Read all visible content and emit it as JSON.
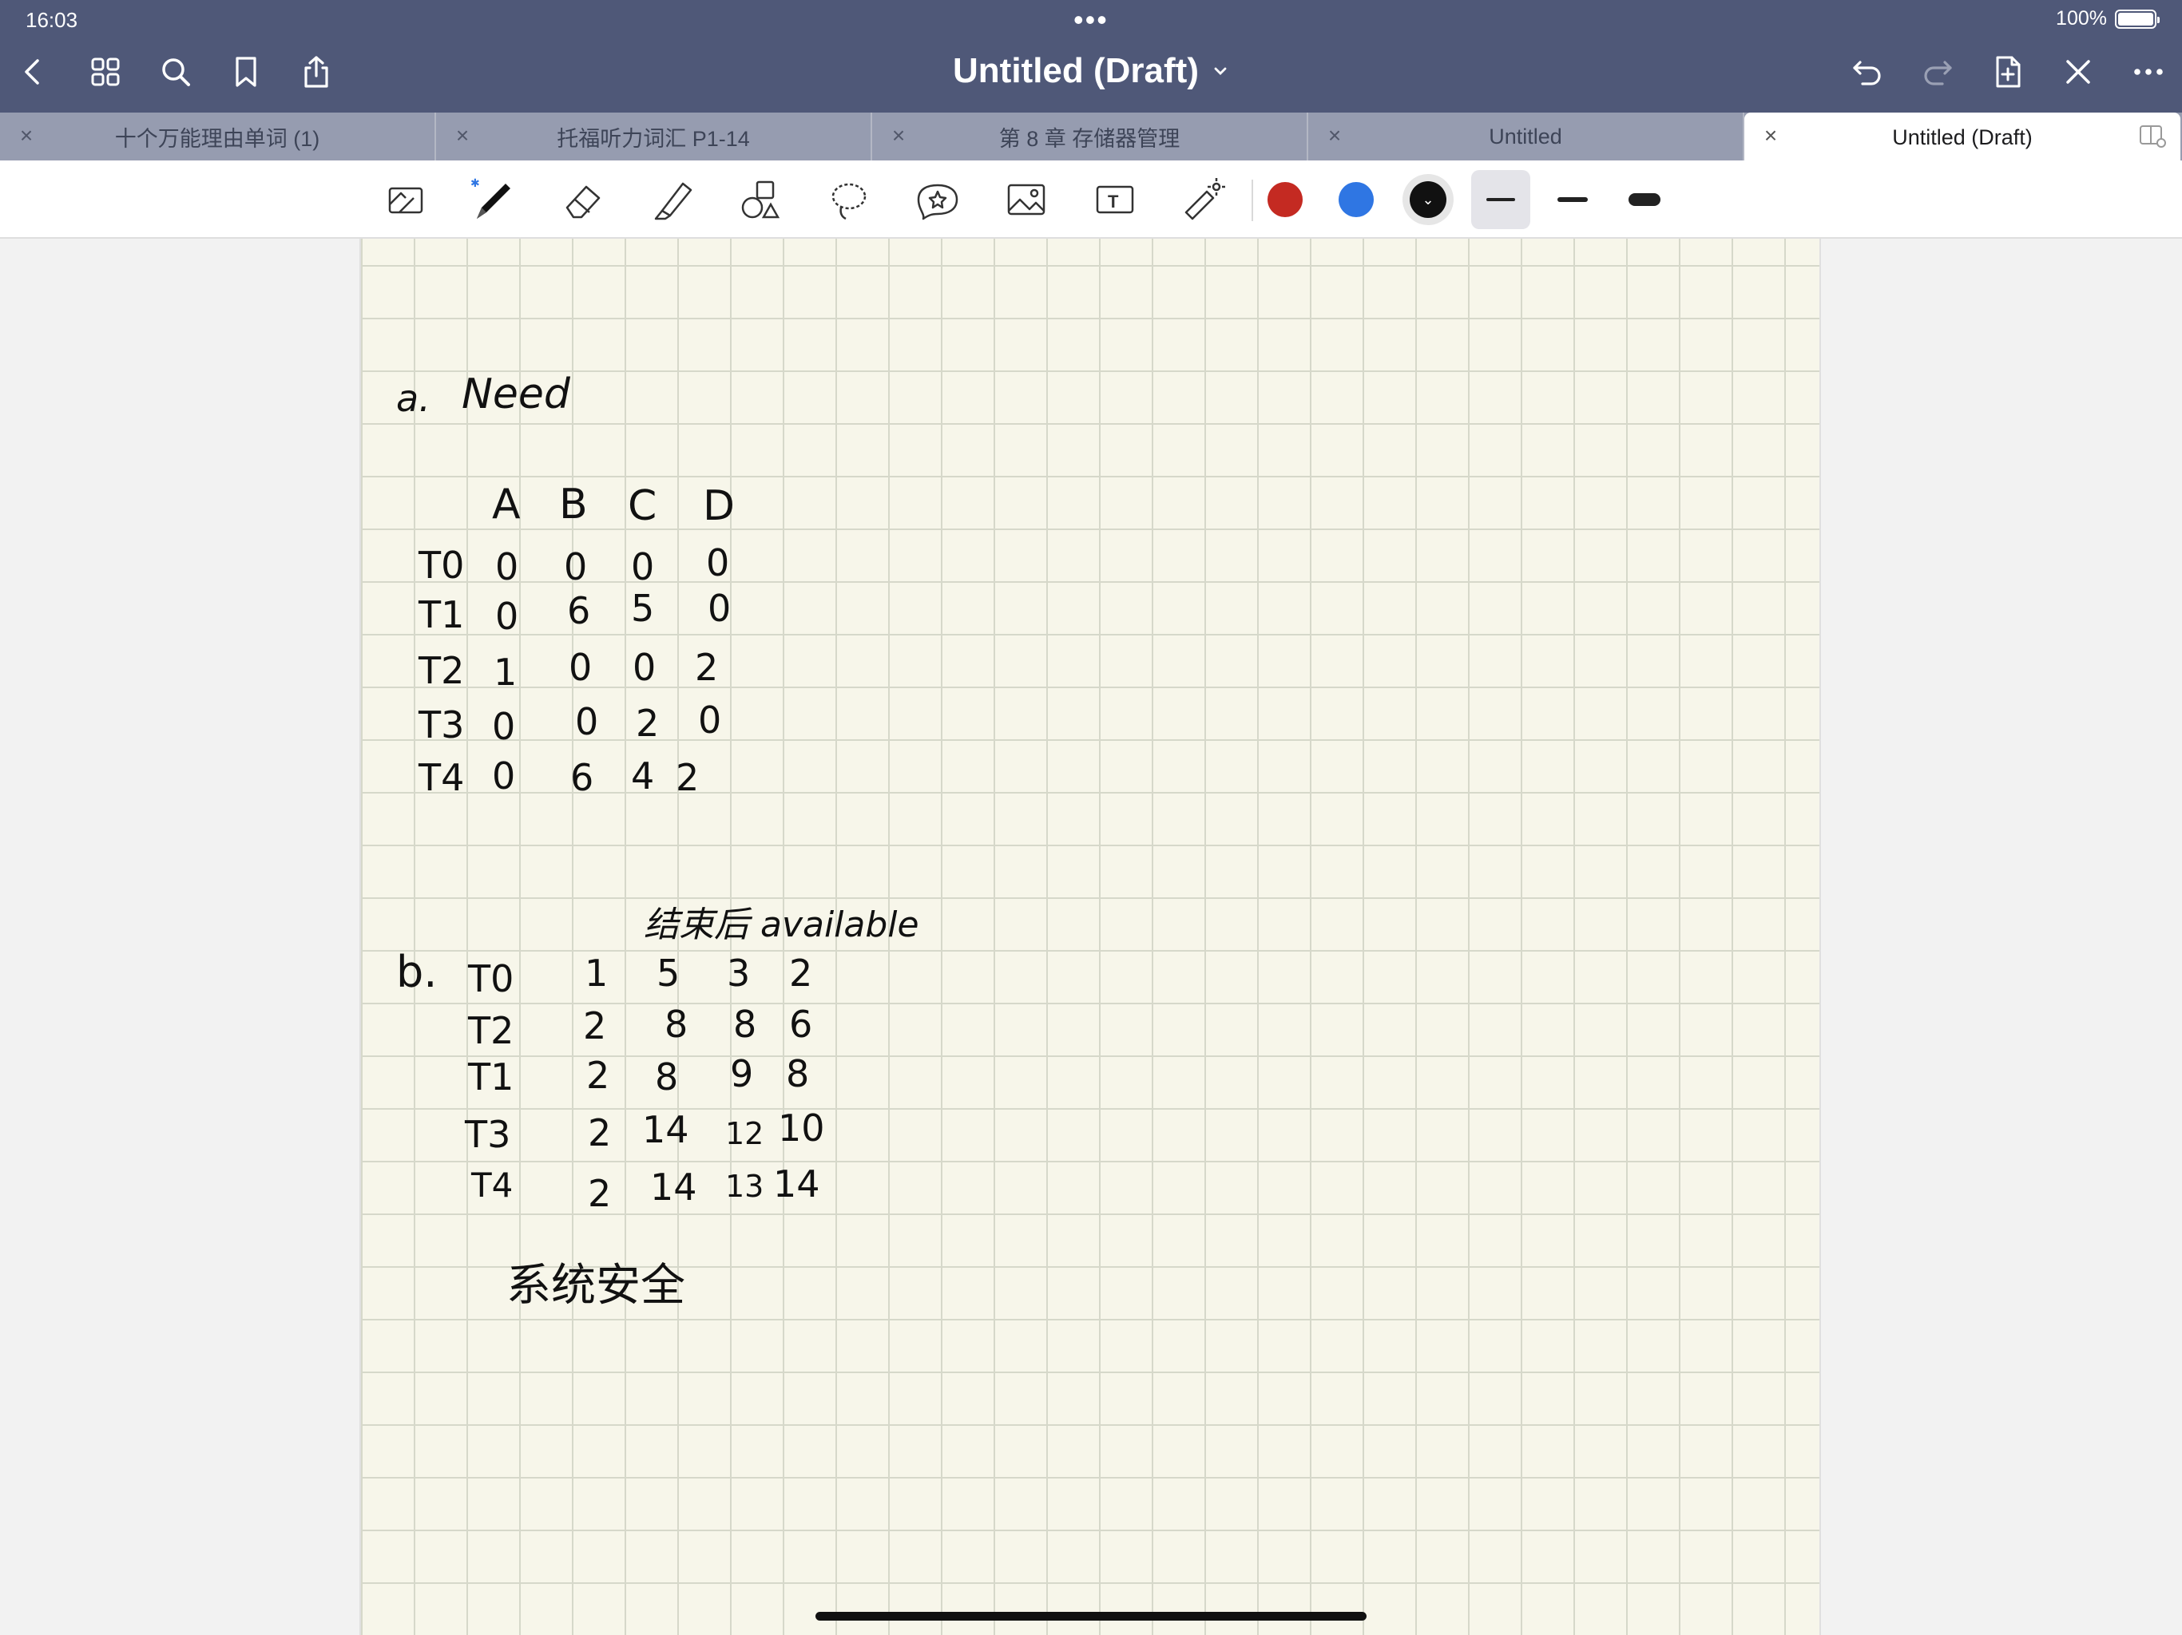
{
  "status_bar": {
    "time": "16:03",
    "battery": "100%",
    "battery_level": 1.0
  },
  "header": {
    "title": "Untitled (Draft)",
    "left_icons": [
      "back-icon",
      "grid-icon",
      "search-icon",
      "bookmark-icon",
      "share-icon"
    ],
    "right_icons": [
      "undo-icon",
      "redo-icon",
      "add-page-icon",
      "close-page-icon",
      "more-icon"
    ]
  },
  "tabs": [
    {
      "label": "十个万能理由单词 (1)",
      "active": false
    },
    {
      "label": "托福听力词汇 P1-14",
      "active": false
    },
    {
      "label": "第 8 章 存储器管理",
      "active": false
    },
    {
      "label": "Untitled",
      "active": false
    },
    {
      "label": "Untitled (Draft)",
      "active": true
    }
  ],
  "toolbar": {
    "tools": [
      "read-only-icon",
      "pen-icon",
      "eraser-icon",
      "highlighter-icon",
      "shapes-icon",
      "lasso-icon",
      "sticker-icon",
      "image-icon",
      "text-icon",
      "laser-pointer-icon"
    ],
    "selected_tool": "pen-icon",
    "colors": [
      "#c42a22",
      "#2f76e3",
      "#111111"
    ],
    "selected_color": "#111111",
    "selected_width": "thin"
  },
  "note": {
    "section_a_label": "a.",
    "section_a_title": "Need",
    "need_columns": [
      "A",
      "B",
      "C",
      "D"
    ],
    "need_rows": [
      {
        "name": "T0",
        "values": [
          "0",
          "0",
          "0",
          "0"
        ]
      },
      {
        "name": "T1",
        "values": [
          "0",
          "6",
          "5",
          "0"
        ]
      },
      {
        "name": "T2",
        "values": [
          "1",
          "0",
          "0",
          "2"
        ]
      },
      {
        "name": "T3",
        "values": [
          "0",
          "0",
          "2",
          "0"
        ]
      },
      {
        "name": "T4",
        "values": [
          "0",
          "6",
          "4",
          "2"
        ]
      }
    ],
    "section_b_heading": "结束后 available",
    "section_b_label": "b.",
    "available_rows": [
      {
        "name": "T0",
        "values": [
          "1",
          "5",
          "3",
          "2"
        ]
      },
      {
        "name": "T2",
        "values": [
          "2",
          "8",
          "8",
          "6"
        ]
      },
      {
        "name": "T1",
        "values": [
          "2",
          "8",
          "9",
          "8"
        ]
      },
      {
        "name": "T3",
        "values": [
          "2",
          "14",
          "12",
          "10"
        ]
      },
      {
        "name": "T4",
        "values": [
          "2",
          "14",
          "13",
          "14"
        ]
      }
    ],
    "conclusion": "系统安全"
  }
}
